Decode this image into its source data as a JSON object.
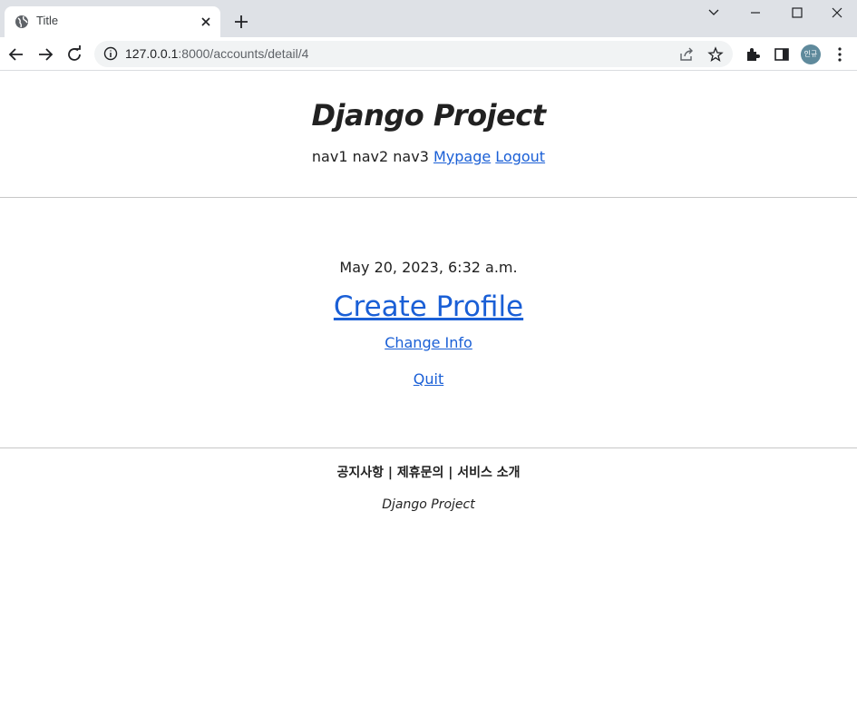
{
  "browser": {
    "tab": {
      "title": "Title"
    },
    "url": {
      "host": "127.0.0.1",
      "rest": ":8000/accounts/detail/4"
    },
    "profile": {
      "initials": "인규"
    }
  },
  "site": {
    "title": "Django Project",
    "nav": {
      "items": [
        "nav1",
        "nav2",
        "nav3"
      ],
      "mypage": "Mypage",
      "logout": "Logout"
    }
  },
  "content": {
    "date": "May 20, 2023, 6:32 a.m.",
    "create_profile": "Create Profile",
    "change_info": "Change Info",
    "quit": "Quit"
  },
  "footer": {
    "links": "공지사항 | 제휴문의 | 서비스 소개",
    "title": "Django Project"
  }
}
